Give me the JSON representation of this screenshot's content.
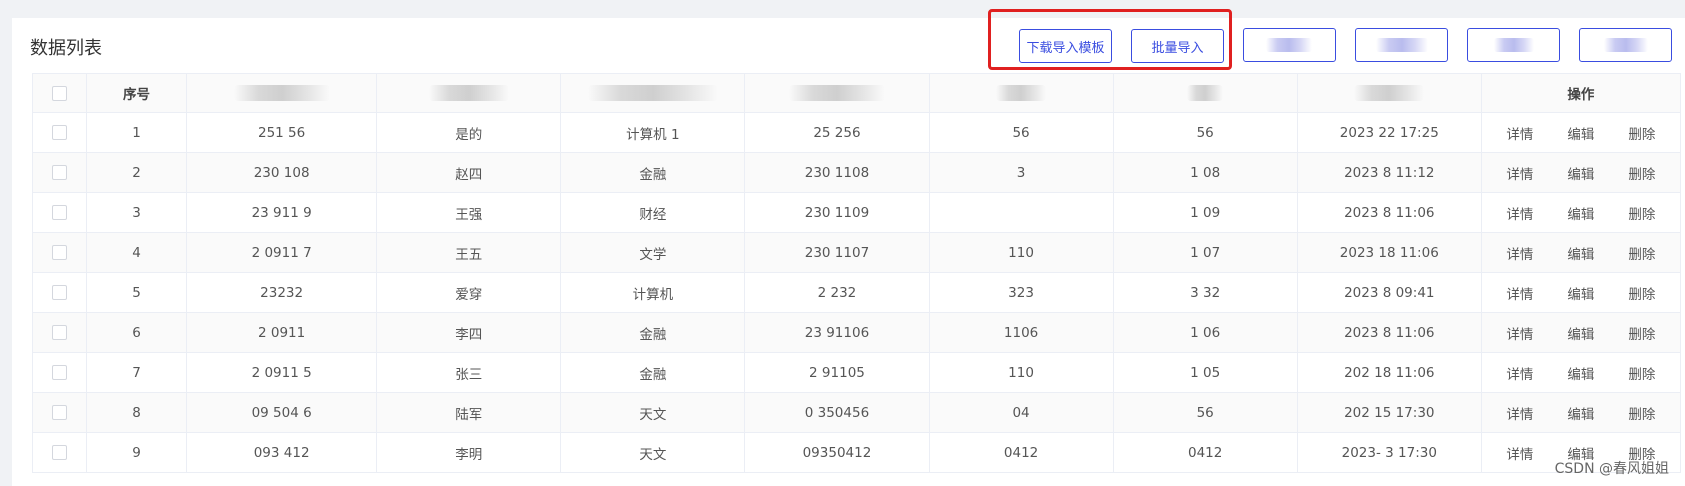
{
  "panel": {
    "title": "数据列表"
  },
  "toolbar": {
    "download_template": "下载导入模板",
    "batch_import": "批量导入"
  },
  "table": {
    "headers": {
      "index": "序号",
      "actions": "操作"
    },
    "rows": [
      {
        "index": "1",
        "col1": "251  56",
        "col2": "是的",
        "col3": "计算机  1",
        "col4": "25  256",
        "col5": "  56",
        "col6": "  56",
        "col7": "2023    22 17:25"
      },
      {
        "index": "2",
        "col1": "230  108",
        "col2": "赵四",
        "col3": "金融",
        "col4": "230  1108",
        "col5": "  3",
        "col6": "1  08",
        "col7": "2023    8 11:12"
      },
      {
        "index": "3",
        "col1": "23  911  9",
        "col2": "王强",
        "col3": "财经",
        "col4": "230  1109",
        "col5": "",
        "col6": "1  09",
        "col7": "2023    8 11:06"
      },
      {
        "index": "4",
        "col1": "2  0911  7",
        "col2": "王五",
        "col3": "文学",
        "col4": "230  1107",
        "col5": "110",
        "col6": "1  07",
        "col7": "2023    18 11:06"
      },
      {
        "index": "5",
        "col1": "23232",
        "col2": "爱穿",
        "col3": "计算机",
        "col4": "2  232",
        "col5": "323",
        "col6": "3  32",
        "col7": "2023    8 09:41"
      },
      {
        "index": "6",
        "col1": "2  0911",
        "col2": "李四",
        "col3": "金融",
        "col4": "23  91106",
        "col5": "1106",
        "col6": "1  06",
        "col7": "2023    8 11:06"
      },
      {
        "index": "7",
        "col1": "2  0911  5",
        "col2": "张三",
        "col3": "金融",
        "col4": "2  91105",
        "col5": "110",
        "col6": "1  05",
        "col7": "202    18 11:06"
      },
      {
        "index": "8",
        "col1": "09  504  6",
        "col2": "陆军",
        "col3": "天文",
        "col4": "0  350456",
        "col5": "04",
        "col6": "  56",
        "col7": "202    15 17:30"
      },
      {
        "index": "9",
        "col1": "093  412",
        "col2": "李明",
        "col3": "天文",
        "col4": "09350412",
        "col5": "0412",
        "col6": "0412",
        "col7": "2023-    3 17:30"
      }
    ],
    "ops": {
      "detail": "详情",
      "edit": "编辑",
      "delete": "删除"
    }
  },
  "watermark": "CSDN @春风姐姐",
  "colors": {
    "accent": "#3a4de0",
    "highlight": "#e02020"
  }
}
